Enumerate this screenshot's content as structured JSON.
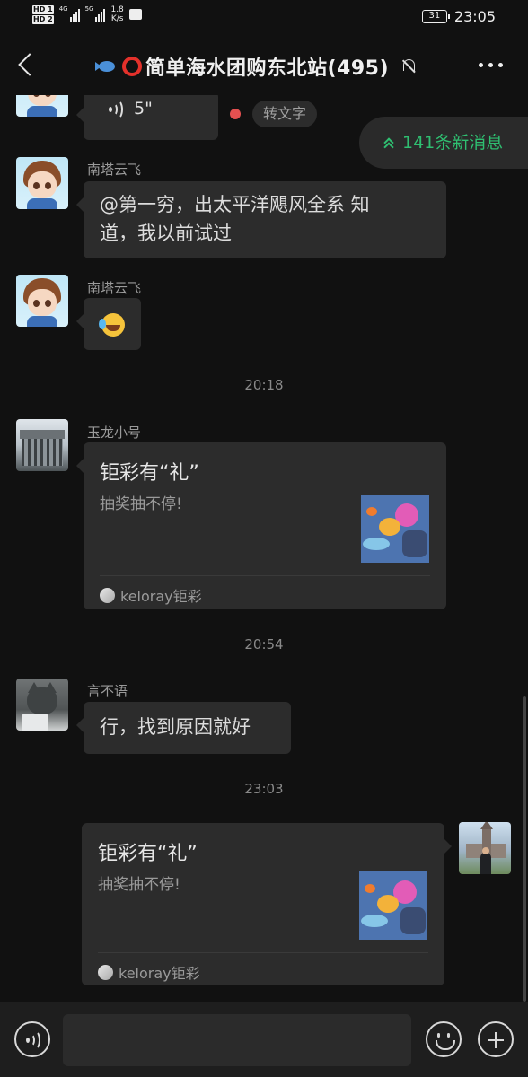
{
  "status_bar": {
    "hd1": "HD 1",
    "hd2": "HD 2",
    "net1": "4G",
    "net2": "5G",
    "speed": "1.8",
    "speed_unit": "K/s",
    "battery": "31",
    "time": "23:05"
  },
  "header": {
    "title": "简单海水团购东北站(495)",
    "icons": [
      "back-icon",
      "fish-emoji-icon",
      "red-circle-emoji-icon",
      "mute-bell-icon",
      "more-icon"
    ]
  },
  "new_messages": {
    "label": "141条新消息"
  },
  "messages": [
    {
      "type": "voice",
      "duration": "5\"",
      "action_label": "转文字"
    },
    {
      "type": "text",
      "sender": "南塔云飞",
      "text_line1": "@第一穷，出太平洋飓风全系  知",
      "text_line2": "道，我以前试过"
    },
    {
      "type": "emoji",
      "sender": "南塔云飞",
      "emoji": "crying-laughing-emoji"
    },
    {
      "type": "time",
      "text": "20:18"
    },
    {
      "type": "card",
      "sender": "玉龙小号",
      "title": "钜彩有“礼”",
      "desc": "抽奖抽不停!",
      "source": "keloray钜彩"
    },
    {
      "type": "time",
      "text": "20:54"
    },
    {
      "type": "text",
      "sender": "言不语",
      "text": "行，找到原因就好"
    },
    {
      "type": "time",
      "text": "23:03"
    },
    {
      "type": "card",
      "self": true,
      "title": "钜彩有“礼”",
      "desc": "抽奖抽不停!",
      "source": "keloray钜彩"
    }
  ],
  "input_bar": {
    "icons": [
      "voice-input-icon",
      "emoji-icon",
      "plus-icon"
    ]
  },
  "colors": {
    "background": "#111111",
    "bubble": "#2c2c2c",
    "accent_green": "#2fbf71",
    "red": "#e45050"
  }
}
